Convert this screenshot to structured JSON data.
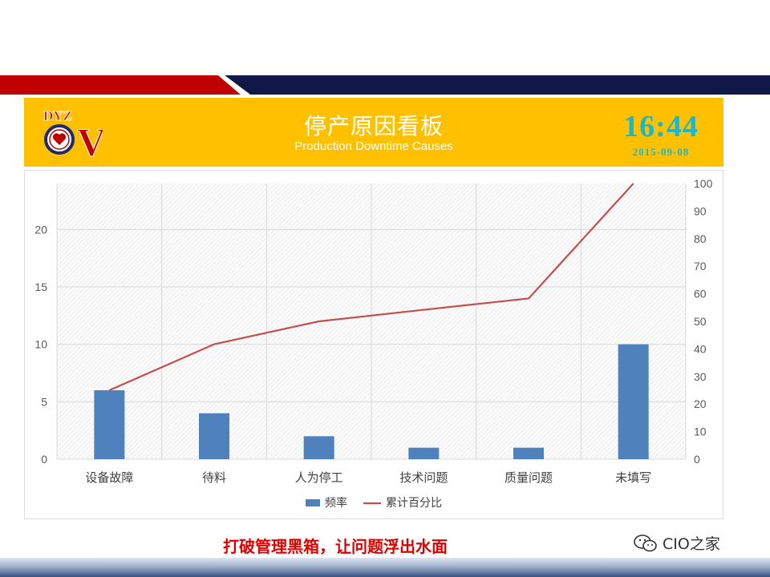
{
  "header": {
    "title_cn": "停产原因看板",
    "title_en": "Production Downtime Causes",
    "time": "16:44",
    "date": "2015-09-08",
    "logo": {
      "letters": "DYZ",
      "big_letter": "V"
    }
  },
  "footer": {
    "slogan": "打破管理黑箱，让问题浮出水面",
    "watermark": "CIO之家"
  },
  "colors": {
    "header_bg": "#ffc000",
    "bar": "#4f81bd",
    "line": "#c0504d",
    "clock": "#17b8cf",
    "slogan": "#e00000",
    "band_red": "#c00000",
    "band_navy": "#0f1846"
  },
  "chart_data": {
    "type": "bar",
    "categories": [
      "设备故障",
      "待料",
      "人为停工",
      "技术问题",
      "质量问题",
      "未填写"
    ],
    "series": [
      {
        "name": "频率",
        "type": "bar",
        "axis": "left",
        "values": [
          6,
          4,
          2,
          1,
          1,
          10
        ]
      },
      {
        "name": "累计百分比",
        "type": "line",
        "axis": "right",
        "values": [
          25,
          41.7,
          50,
          54.2,
          58.3,
          100
        ]
      }
    ],
    "y_left": {
      "ticks": [
        0,
        5,
        10,
        15,
        20
      ],
      "lim": [
        0,
        24
      ]
    },
    "y_right": {
      "ticks": [
        0,
        10,
        20,
        30,
        40,
        50,
        60,
        70,
        80,
        90,
        100
      ],
      "lim": [
        0,
        100
      ]
    },
    "grid": true,
    "legend_position": "bottom"
  }
}
